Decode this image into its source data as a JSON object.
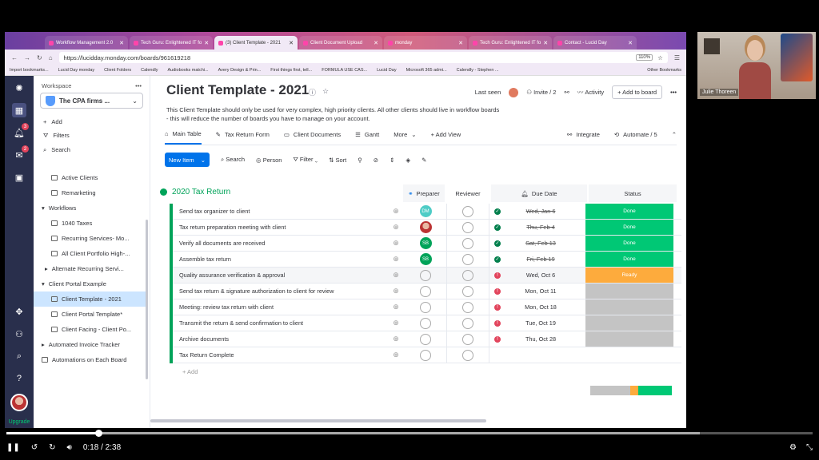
{
  "browser": {
    "tabs": [
      {
        "label": "Workflow Management 2.0"
      },
      {
        "label": "Tech Guru: Enlightened IT fo"
      },
      {
        "label": "(3) Client Template - 2021"
      },
      {
        "label": "Client Document Upload"
      },
      {
        "label": "monday"
      },
      {
        "label": "Tech Guru: Enlightened IT fo"
      },
      {
        "label": "Contact - Lucid Day"
      }
    ],
    "url": "https://lucidday.monday.com/boards/961619218",
    "zoom": "110%",
    "bookmarks": [
      "Import bookmarks...",
      "Lucid Day monday",
      "Client Folders",
      "Calendly",
      "Audiobooks matchi...",
      "Avery Design & Prin...",
      "First things first, tell...",
      "FORMULA USE CAS...",
      "Lucid Day",
      "Microsoft 365 admi...",
      "Calendly - Stephen ...",
      "Other Bookmarks"
    ]
  },
  "rail": {
    "notif_badge": "3",
    "inbox_badge": "2",
    "upgrade_label": "Upgrade"
  },
  "sidebar": {
    "workspace_label": "Workspace",
    "workspace_name": "The CPA firms ...",
    "actions": {
      "add": "Add",
      "filters": "Filters",
      "search": "Search"
    },
    "items": [
      {
        "label": "Active Clients",
        "type": "board"
      },
      {
        "label": "Remarketing",
        "type": "board"
      },
      {
        "label": "Workflows",
        "type": "folder"
      },
      {
        "label": "1040 Taxes",
        "type": "board"
      },
      {
        "label": "Recurring Services- Mo...",
        "type": "board"
      },
      {
        "label": "All Client Portfolio High-...",
        "type": "board"
      },
      {
        "label": "Alternate Recurring Servi...",
        "type": "sub"
      },
      {
        "label": "Client Portal Example",
        "type": "folder"
      },
      {
        "label": "Client Template - 2021",
        "type": "board",
        "selected": true
      },
      {
        "label": "Client Portal Template*",
        "type": "board"
      },
      {
        "label": "Client Facing - Client Po...",
        "type": "board"
      },
      {
        "label": "Automated Invoice Tracker",
        "type": "sub"
      },
      {
        "label": "Automations on Each Board",
        "type": "root"
      }
    ]
  },
  "board": {
    "title": "Client Template - 2021",
    "last_seen": "Last seen",
    "invite": "Invite / 2",
    "activity": "Activity",
    "add_to_board": "Add to board",
    "description_1": "This Client Template should only be used for very complex, high priority clients. All other clients should live in workflow boards",
    "description_2": "- this will reduce the number of boards you have to manage on your account.",
    "views": [
      "Main Table",
      "Tax Return Form",
      "Client Documents",
      "Gantt",
      "More",
      "+ Add View"
    ],
    "integrate": "Integrate",
    "automate": "Automate / 5",
    "toolbar": {
      "new_item": "New Item",
      "search": "Search",
      "person": "Person",
      "filter": "Filter",
      "sort": "Sort"
    },
    "group": {
      "title": "2020 Tax Return",
      "columns": {
        "preparer": "Preparer",
        "reviewer": "Reviewer",
        "due_date": "Due Date",
        "status": "Status"
      },
      "add_label": "+ Add"
    },
    "rows": [
      {
        "name": "Send tax organizer to client",
        "preparer": "DM",
        "due": "Wed, Jan 6",
        "done": true,
        "status": "Done"
      },
      {
        "name": "Tax return preparation meeting with client",
        "preparer": "photo",
        "due": "Thu, Feb 4",
        "done": true,
        "status": "Done"
      },
      {
        "name": "Verify all documents are received",
        "preparer": "SB",
        "due": "Sat, Feb 13",
        "done": true,
        "status": "Done"
      },
      {
        "name": "Assemble tax return",
        "preparer": "SB",
        "due": "Fri, Feb 19",
        "done": true,
        "status": "Done"
      },
      {
        "name": "Quality assurance verification & approval",
        "preparer": "",
        "due": "Wed, Oct 6",
        "done": false,
        "status": "Ready"
      },
      {
        "name": "Send tax return & signature authorization to client for review",
        "preparer": "",
        "due": "Mon, Oct 11",
        "done": false,
        "status": ""
      },
      {
        "name": "Meeting: review tax return with client",
        "preparer": "",
        "due": "Mon, Oct 18",
        "done": false,
        "status": ""
      },
      {
        "name": "Transmit the return & send confirmation to client",
        "preparer": "",
        "due": "Tue, Oct 19",
        "done": false,
        "status": ""
      },
      {
        "name": "Archive documents",
        "preparer": "",
        "due": "Thu, Oct 28",
        "done": false,
        "status": ""
      },
      {
        "name": "Tax Return Complete",
        "preparer": "",
        "due": "",
        "done": false,
        "status": ""
      }
    ]
  },
  "webcam": {
    "name": "Julie Thoreen"
  },
  "player": {
    "current": "0:18",
    "duration": "2:38",
    "progress": 0.114,
    "buffered": 0.86
  },
  "colors": {
    "done": "#00c875",
    "ready": "#fdab3d",
    "empty": "#c4c4c4",
    "brand": "#0073ea",
    "group": "#00a359"
  }
}
